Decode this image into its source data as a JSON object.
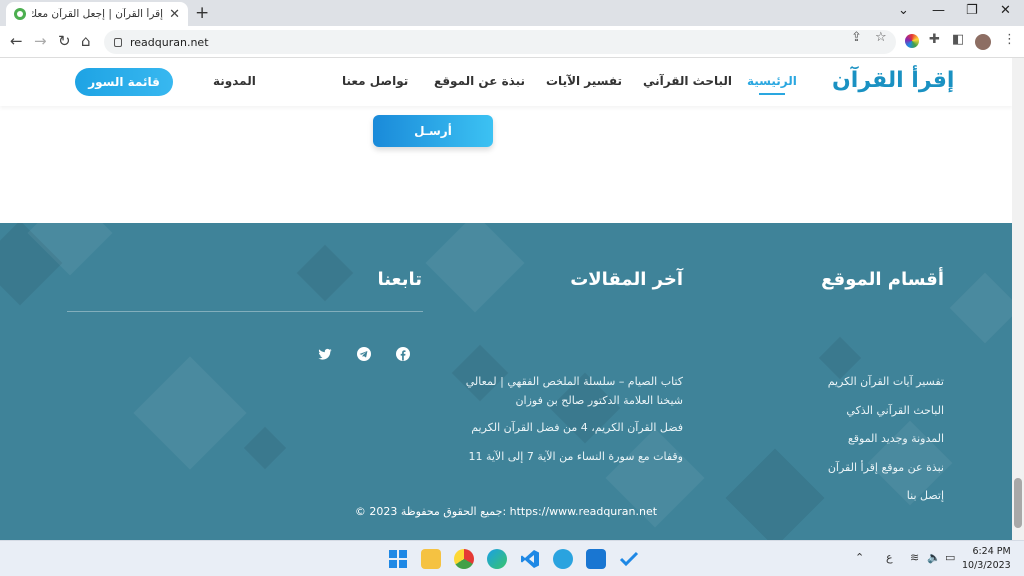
{
  "browser": {
    "tab_title": "إقرأ القرآن | إجعل القرآن معك في",
    "url": "readquran.net",
    "window_controls": [
      "⌄",
      "—",
      "❐",
      "✕"
    ]
  },
  "header": {
    "logo": "إقرأ القرآن",
    "nav": [
      "الرئيسية",
      "الباحث القرآني",
      "تفسير الآيات",
      "نبذة عن الموقع",
      "تواصل معنا",
      "المدونة"
    ],
    "cta": "قائمة السور"
  },
  "form": {
    "send_label": "أرسـل"
  },
  "footer": {
    "sections_title": "أقسام الموقع",
    "sections": [
      "تفسير آيات القرآن الكريم",
      "الباحث القرآني الذكي",
      "المدونة وجديد الموقع",
      "نبذة عن موقع إقرأ القرآن",
      "إتصل بنا"
    ],
    "articles_title": "آخر المقالات",
    "articles": [
      "كتاب الصيام – سلسلة الملخص الفقهي | لمعالي",
      "شيخنا العلامة الدكتور صالح بن فوزان",
      "فضل القرآن الكريم، 4 من فضل القرآن الكريم",
      "وقفات مع سورة النساء من الآية 7 إلى الآية 11"
    ],
    "follow_title": "تابعنا",
    "copyright": "© 2023 جميع الحقوق محفوظة: https://www.readquran.net"
  },
  "taskbar": {
    "lang": "ع",
    "time": "6:24 PM",
    "date": "10/3/2023"
  }
}
